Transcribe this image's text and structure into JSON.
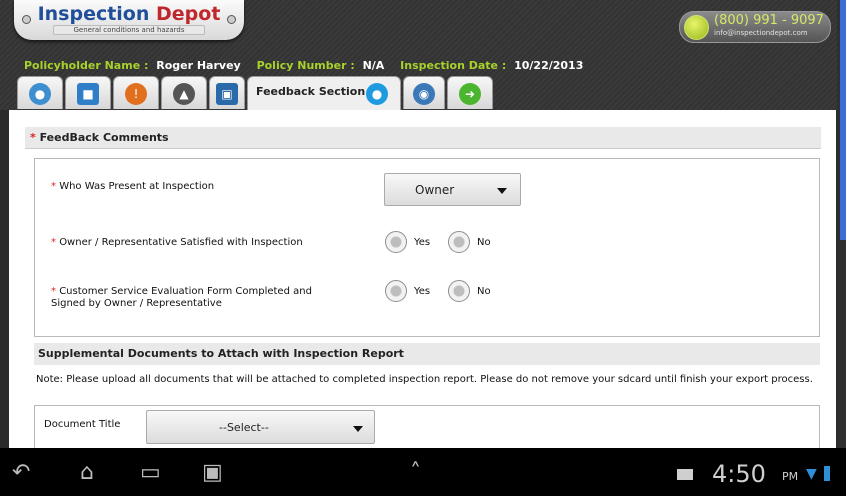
{
  "header": {
    "logo_title_a": "Inspection ",
    "logo_title_b": "Depot",
    "logo_subtitle": "General conditions and hazards",
    "phone": "(800) 991 - 9097",
    "email": "info@inspectiondepot.com"
  },
  "info": {
    "policyholder_label": "Policyholder Name :",
    "policyholder_value": "Roger Harvey",
    "policy_label": "Policy Number :",
    "policy_value": "N/A",
    "date_label": "Inspection Date :",
    "date_value": "10/22/2013"
  },
  "tabs": [
    {
      "icon": "people-icon",
      "color": "#3e8fd0"
    },
    {
      "icon": "book-icon",
      "color": "#2f7fc8"
    },
    {
      "icon": "warning-icon",
      "color": "#e07020"
    },
    {
      "icon": "hammer-icon",
      "color": "#555555"
    },
    {
      "icon": "photo-icon",
      "color": "#2b6aa8"
    },
    {
      "label": "Feedback Section",
      "icon": "chat-icon",
      "color": "#1e9be0",
      "active": true
    },
    {
      "icon": "globe-icon",
      "color": "#3a78b8"
    },
    {
      "icon": "arrow-right-icon",
      "color": "#4bb52f"
    }
  ],
  "feedback": {
    "header": "FeedBack Comments",
    "q1": "Who Was Present at Inspection",
    "q1_value": "Owner",
    "q2": "Owner / Representative Satisfied with Inspection",
    "q3_line1": "Customer Service Evaluation Form Completed and",
    "q3_line2": "Signed by Owner / Representative",
    "yes": "Yes",
    "no": "No",
    "required_mark": "*"
  },
  "supplemental": {
    "header": "Supplemental Documents to Attach with Inspection Report",
    "note": "Note: Please upload all documents that will be attached to completed inspection report. Please do not remove your sdcard until finish your export process.",
    "doc_title_label": "Document Title",
    "doc_title_value": "--Select--"
  },
  "statusbar": {
    "time": "4:50",
    "ampm": "PM"
  }
}
